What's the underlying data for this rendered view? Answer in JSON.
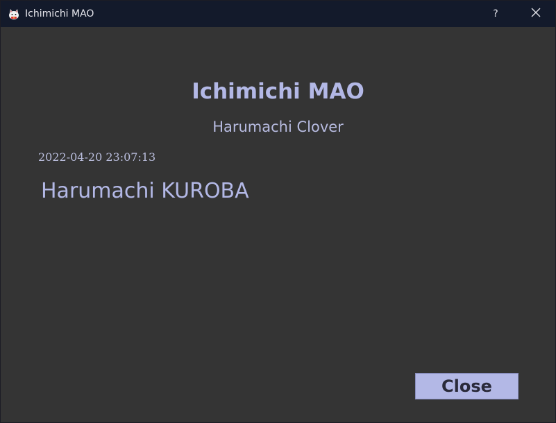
{
  "window": {
    "title": "Ichimichi MAO",
    "help_label": "?",
    "app_icon": "cat-mascot-icon",
    "close_icon": "close-icon"
  },
  "dialog": {
    "title": "Ichimichi MAO",
    "subtitle": "Harumachi Clover",
    "timestamp": "2022-04-20 23:07:13",
    "author": "Harumachi KUROBA",
    "close_label": "Close"
  },
  "colors": {
    "titlebar_bg": "#131a2b",
    "window_bg": "#343434",
    "accent_text": "#b3b8e6",
    "button_bg": "#b3b8e6",
    "button_text": "#2a2a3a"
  }
}
